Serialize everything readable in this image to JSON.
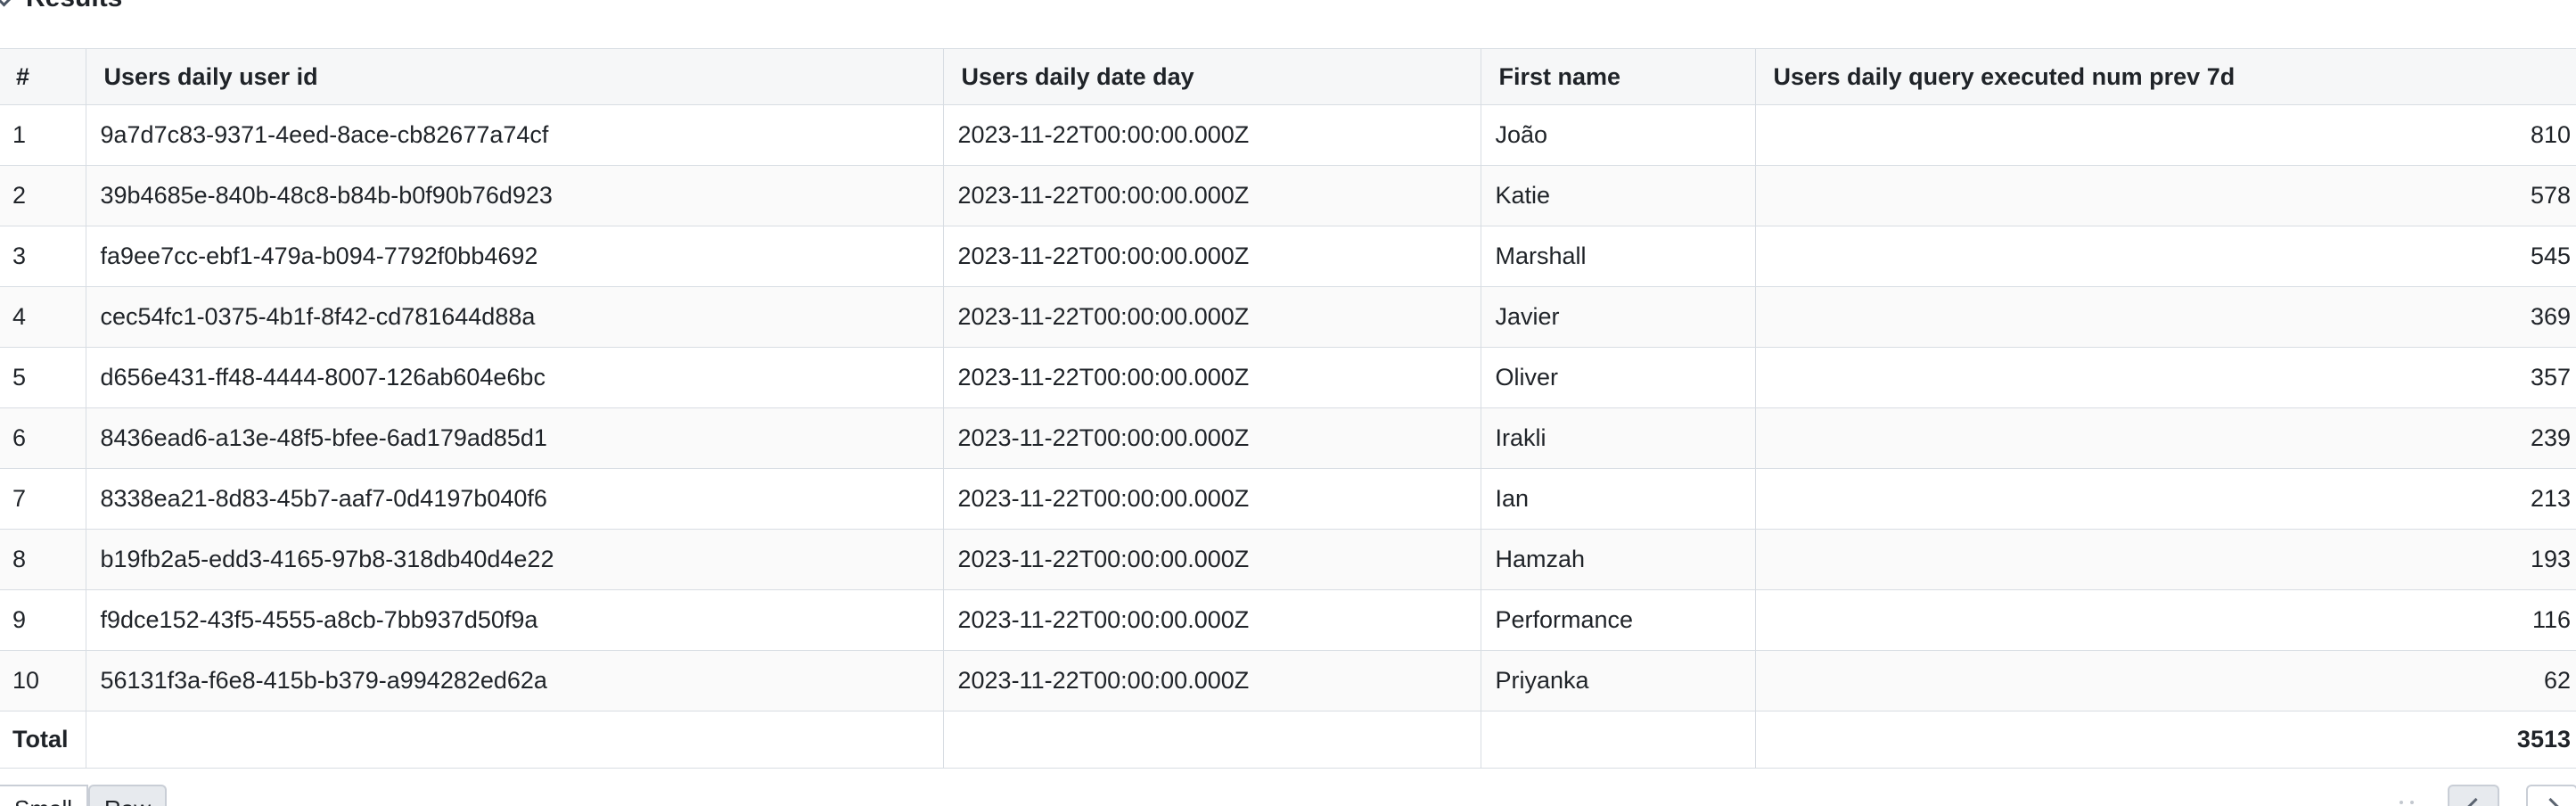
{
  "section": {
    "title": "Results"
  },
  "table": {
    "headers": [
      "#",
      "Users daily user id",
      "Users daily date day",
      "First name",
      "Users daily query executed num prev 7d"
    ],
    "rows": [
      [
        "1",
        "9a7d7c83-9371-4eed-8ace-cb82677a74cf",
        "2023-11-22T00:00:00.000Z",
        "João",
        "810"
      ],
      [
        "2",
        "39b4685e-840b-48c8-b84b-b0f90b76d923",
        "2023-11-22T00:00:00.000Z",
        "Katie",
        "578"
      ],
      [
        "3",
        "fa9ee7cc-ebf1-479a-b094-7792f0bb4692",
        "2023-11-22T00:00:00.000Z",
        "Marshall",
        "545"
      ],
      [
        "4",
        "cec54fc1-0375-4b1f-8f42-cd781644d88a",
        "2023-11-22T00:00:00.000Z",
        "Javier",
        "369"
      ],
      [
        "5",
        "d656e431-ff48-4444-8007-126ab604e6bc",
        "2023-11-22T00:00:00.000Z",
        "Oliver",
        "357"
      ],
      [
        "6",
        "8436ead6-a13e-48f5-bfee-6ad179ad85d1",
        "2023-11-22T00:00:00.000Z",
        "Irakli",
        "239"
      ],
      [
        "7",
        "8338ea21-8d83-45b7-aaf7-0d4197b040f6",
        "2023-11-22T00:00:00.000Z",
        "Ian",
        "213"
      ],
      [
        "8",
        "b19fb2a5-edd3-4165-97b8-318db40d4e22",
        "2023-11-22T00:00:00.000Z",
        "Hamzah",
        "193"
      ],
      [
        "9",
        "f9dce152-43f5-4555-a8cb-7bb937d50f9a",
        "2023-11-22T00:00:00.000Z",
        "Performance",
        "116"
      ],
      [
        "10",
        "56131f3a-f6e8-415b-b379-a994282ed62a",
        "2023-11-22T00:00:00.000Z",
        "Priyanka",
        "62"
      ]
    ],
    "total_label": "Total",
    "total_value": "3513"
  },
  "bottom": {
    "toggle_left_label": "Small",
    "toggle_right_label": "Raw"
  },
  "colors": {
    "header_bg": "#f6f7f8",
    "border": "#d8dde3",
    "active_button_bg": "#e7eaee"
  }
}
